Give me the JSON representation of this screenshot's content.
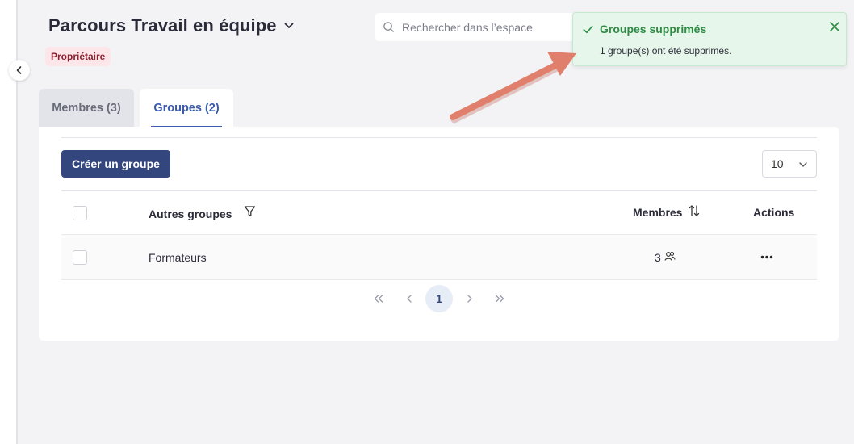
{
  "header": {
    "title": "Parcours Travail en équipe",
    "role_badge": "Propriétaire"
  },
  "search": {
    "placeholder": "Rechercher dans l’espace"
  },
  "toast": {
    "title": "Groupes supprimés",
    "message": "1 groupe(s) ont été supprimés."
  },
  "tabs": [
    {
      "label": "Membres (3)",
      "active": false
    },
    {
      "label": "Groupes (2)",
      "active": true
    }
  ],
  "toolbar": {
    "create_label": "Créer un groupe",
    "page_size": "10"
  },
  "table": {
    "columns": {
      "name": "Autres groupes",
      "members": "Membres",
      "actions": "Actions"
    },
    "rows": [
      {
        "name": "Formateurs",
        "members": "3"
      }
    ]
  },
  "pagination": {
    "current": "1"
  },
  "colors": {
    "accent": "#33467e",
    "tab_active": "#3a5bab",
    "toast_bg": "#e7f6ea",
    "toast_text": "#2e8b44",
    "badge_bg": "#fde6ea",
    "annotation_arrow": "#e0806c"
  },
  "icons": {
    "title_dropdown": "chevron-down-icon",
    "search": "search-icon",
    "toast_check": "check-icon",
    "toast_close": "close-icon",
    "sidebar_toggle": "chevron-left-icon",
    "filter": "filter-icon",
    "sort": "sort-icon",
    "members": "users-icon",
    "actions": "more-horizontal-icon"
  }
}
